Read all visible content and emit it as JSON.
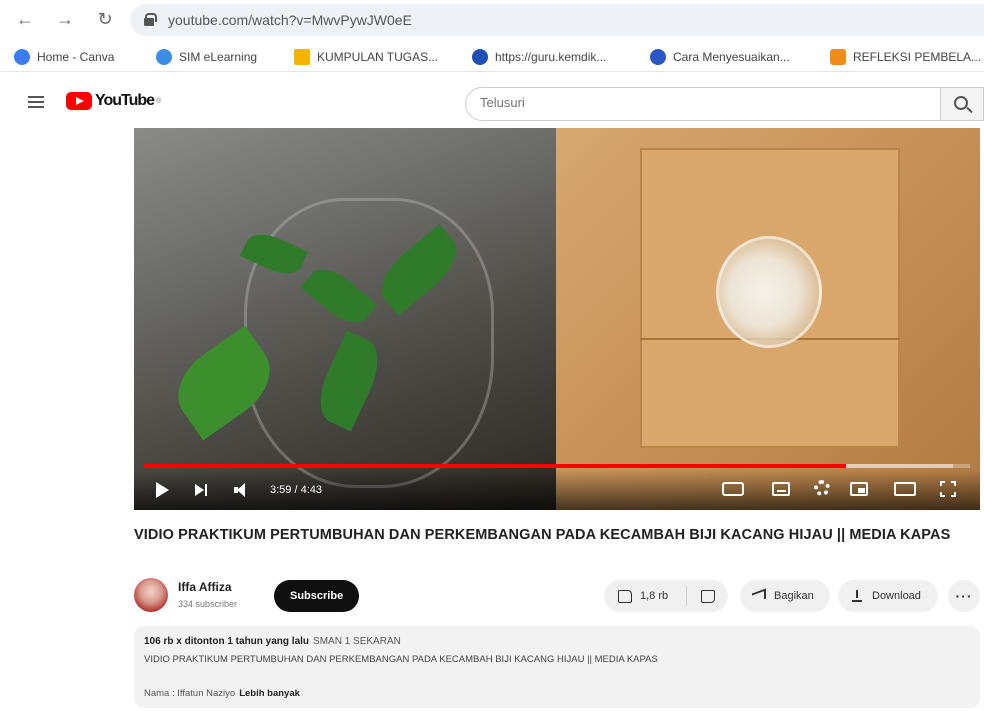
{
  "browser": {
    "url": "youtube.com/watch?v=MwvPywJW0eE",
    "bookmarks": [
      {
        "label": "Home - Canva",
        "color": "#3b7cf0"
      },
      {
        "label": "SIM eLearning",
        "color": "#3a8ee6"
      },
      {
        "label": "KUMPULAN TUGAS...",
        "color": "#f4b400"
      },
      {
        "label": "https://guru.kemdik...",
        "color": "#1f4fb8"
      },
      {
        "label": "Cara Menyesuaikan...",
        "color": "#2a56c6"
      },
      {
        "label": "REFLEKSI PEMBELA...",
        "color": "#f28b1e"
      }
    ]
  },
  "youtube": {
    "logo_text": "YouTube",
    "search_placeholder": "Telusuri"
  },
  "player": {
    "time": "3:59 / 4:43",
    "progress_fraction": 0.85,
    "buffer_fraction": 0.98
  },
  "video": {
    "title": "VIDIO PRAKTIKUM PERTUMBUHAN DAN PERKEMBANGAN PADA KECAMBAH BIJI KACANG HIJAU || MEDIA KAPAS"
  },
  "channel": {
    "name": "Iffa Affiza",
    "subscribers": "334 subscriber",
    "subscribe_label": "Subscribe"
  },
  "actions": {
    "likes": "1,8 rb",
    "share_label": "Bagikan",
    "download_label": "Download",
    "more_label": "···"
  },
  "description": {
    "views_date": "106 rb x ditonton  1 tahun yang lalu",
    "school": "SMAN 1 SEKARAN",
    "text": "VIDIO PRAKTIKUM PERTUMBUHAN DAN PERKEMBANGAN PADA KECAMBAH BIJI KACANG HIJAU || MEDIA KAPAS",
    "name_line": "Nama : Iffatun Naziyo",
    "more_label": "Lebih banyak"
  },
  "colors": {
    "accent": "#ff0000",
    "subscribe_bg": "#0f0f0f"
  }
}
